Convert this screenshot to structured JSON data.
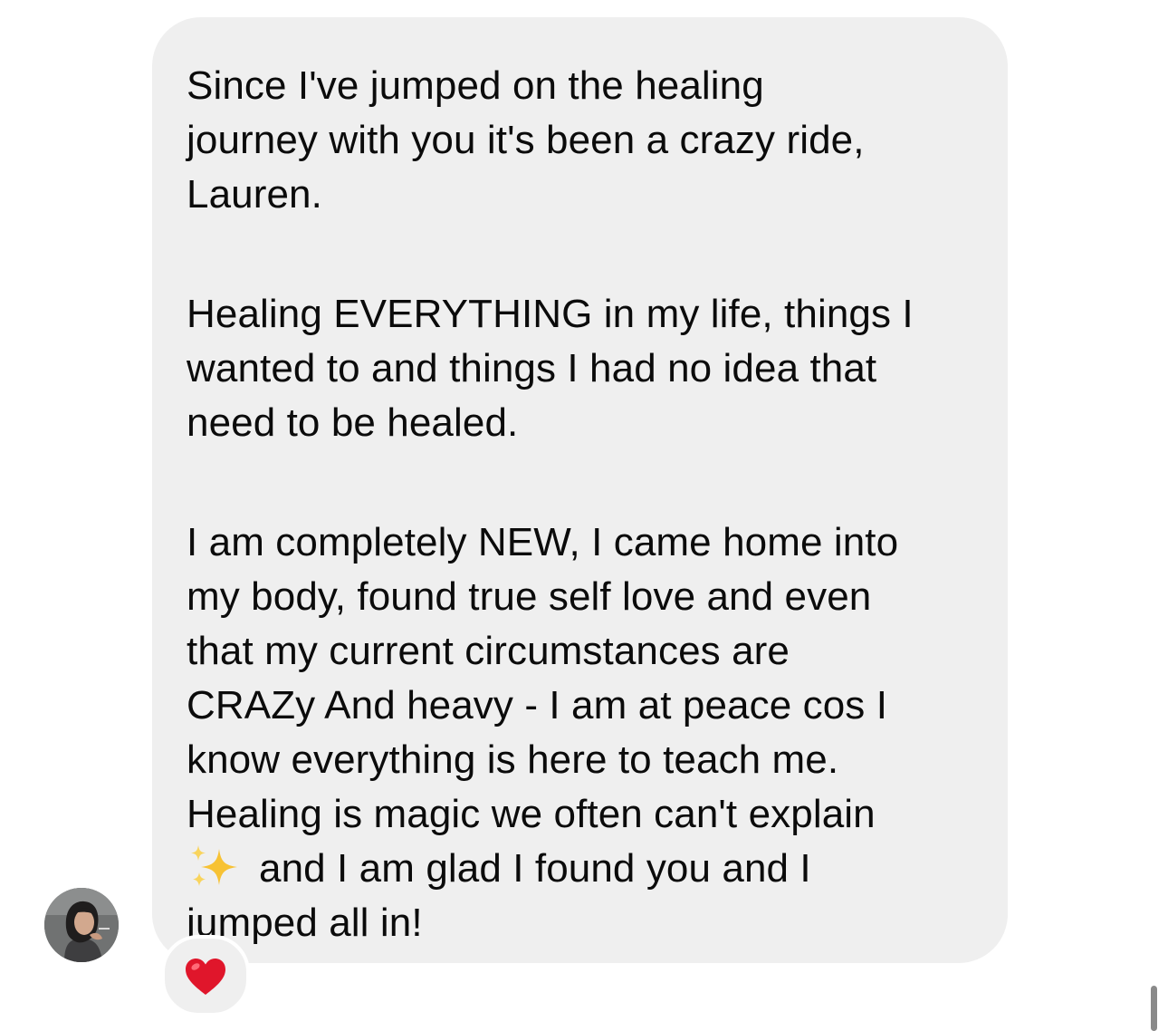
{
  "message": {
    "paragraphs": [
      {
        "lines": [
          "Since I've jumped on the healing",
          "journey with you it's been a crazy ride,",
          "Lauren."
        ]
      },
      {
        "lines": [
          "Healing EVERYTHING in my life, things I",
          "wanted to and things I had no idea that",
          "need to be healed."
        ]
      },
      {
        "lines": [
          "I am completely NEW, I came home into",
          "my body, found true self love and even",
          "that my current circumstances are",
          "CRAZy And heavy - I am at peace cos I",
          "know everything is here to teach me.",
          "Healing is magic we often can't explain",
          "and I am glad I found you and I",
          "jumped all in!"
        ]
      }
    ],
    "inline_emoji": "sparkles-emoji",
    "reaction": "red-heart-emoji"
  },
  "avatar": {
    "icon": "profile-photo"
  },
  "colors": {
    "bubble": "#efefef",
    "text": "#0b0b0b",
    "heart": "#e0162b",
    "sparkle": "#f7c234"
  }
}
